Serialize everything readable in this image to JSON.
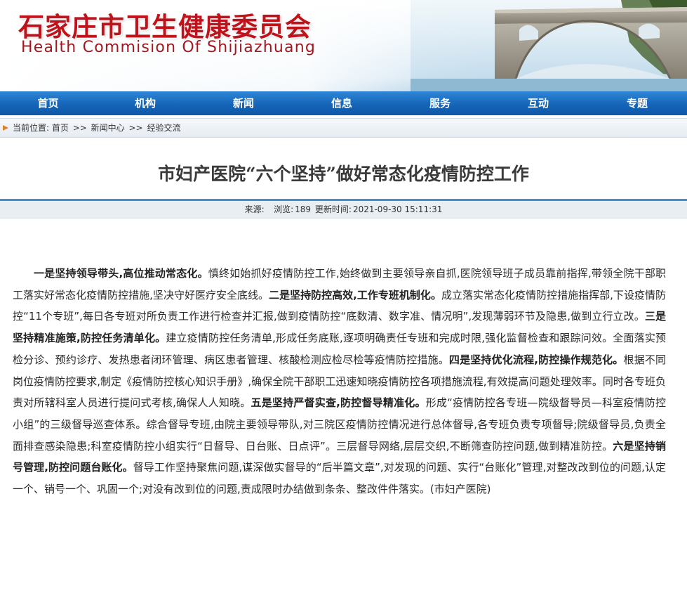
{
  "header": {
    "title_cn": "石家庄市卫生健康委员会",
    "title_en": "Health Commision Of Shijiazhuang"
  },
  "nav": {
    "items": [
      "首页",
      "机构",
      "新闻",
      "信息",
      "服务",
      "互动",
      "专题"
    ]
  },
  "breadcrumb": {
    "prefix": "当前位置:",
    "home": "首页",
    "sep1": ">>",
    "news": "新闻中心",
    "sep2": ">>",
    "current": "经验交流"
  },
  "article": {
    "title": "市妇产医院“六个坚持”做好常态化疫情防控工作",
    "meta": {
      "source_label": "来源:",
      "views_label": "浏览:",
      "views": "189",
      "updated_label": "更新时间:",
      "updated": "2021-09-30 15:11:31"
    },
    "segments": [
      {
        "t": "一是坚持领导带头,高位推动常态化。",
        "b": true
      },
      {
        "t": "慎终如始抓好疫情防控工作,始终做到主要领导亲自抓,医院领导班子成员靠前指挥,带领全院干部职工落实好常态化疫情防控措施,坚决守好医疗安全底线。",
        "b": false
      },
      {
        "t": "二是坚持防控高效,工作专班机制化。",
        "b": true
      },
      {
        "t": "成立落实常态化疫情防控措施指挥部,下设疫情防控“11个专班”,每日各专班对所负责工作进行检查并汇报,做到疫情防控“底数清、数字准、情况明”,发现薄弱环节及隐患,做到立行立改。",
        "b": false
      },
      {
        "t": "三是坚持精准施策,防控任务清单化。",
        "b": true
      },
      {
        "t": "建立疫情防控任务清单,形成任务底账,逐项明确责任专班和完成时限,强化监督检查和跟踪问效。全面落实预检分诊、预约诊疗、发热患者闭环管理、病区患者管理、核酸检测应检尽检等疫情防控措施。",
        "b": false
      },
      {
        "t": "四是坚持优化流程,防控操作规范化。",
        "b": true
      },
      {
        "t": "根据不同岗位疫情防控要求,制定《疫情防控核心知识手册》,确保全院干部职工迅速知晓疫情防控各项措施流程,有效提高问题处理效率。同时各专班负责对所辖科室人员进行提问式考核,确保人人知晓。",
        "b": false
      },
      {
        "t": "五是坚持严督实查,防控督导精准化。",
        "b": true
      },
      {
        "t": "形成“疫情防控各专班—院级督导员—科室疫情防控小组”的三级督导巡查体系。综合督导专班,由院主要领导带队,对三院区疫情防控情况进行总体督导,各专班负责专项督导;院级督导员,负责全面排查感染隐患;科室疫情防控小组实行“日督导、日台账、日点评”。三层督导网络,层层交织,不断筛查防控问题,做到精准防控。",
        "b": false
      },
      {
        "t": "六是坚持销号管理,防控问题台账化。",
        "b": true
      },
      {
        "t": "督导工作坚持聚焦问题,谋深做实督导的“后半篇文章”,对发现的问题、实行“台账化”管理,对整改改到位的问题,认定一个、销号一个、巩固一个;对没有改到位的问题,责成限时办结做到条条、整改件件落实。(市妇产医院)",
        "b": false
      }
    ]
  },
  "colors": {
    "brand_red": "#c0121a",
    "nav_blue": "#1565b8",
    "accent_rule": "#3f8fd3"
  }
}
